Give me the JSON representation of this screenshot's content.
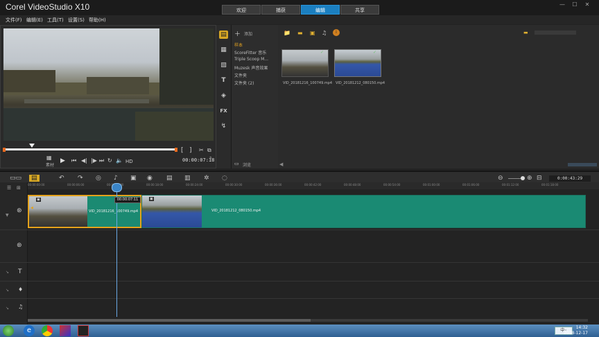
{
  "app": {
    "title": "Corel VideoStudio X10",
    "tabs": [
      {
        "label": "欢迎"
      },
      {
        "label": "捕获"
      },
      {
        "label": "编辑"
      },
      {
        "label": "共享"
      }
    ],
    "active_tab": "编辑",
    "menu": [
      "文件(F)",
      "编辑(E)",
      "工具(T)",
      "设置(S)",
      "帮助(H)"
    ]
  },
  "player": {
    "mode_label": "素材",
    "hd_label": "HD",
    "timecode": "00:00:07:18"
  },
  "library": {
    "add_label": "添加",
    "tree": [
      "样本",
      "ScoreFitter 音乐",
      "Triple Scoop M...",
      "Muzesk 声音效果",
      "文件夹",
      "文件夹 (2)"
    ],
    "browse_label": "浏览",
    "thumbnails": [
      {
        "name": "VID_20181216_100749.mp4"
      },
      {
        "name": "VID_20181212_080150.mp4"
      }
    ]
  },
  "timeline": {
    "duration": "0:00:43:29",
    "ruler_ticks": [
      "00:00:00:00",
      "00:00:06:00",
      "00:00:12:00",
      "00:00:18:00",
      "00:00:24:00",
      "00:00:30:00",
      "00:00:36:00",
      "00:00:42:00",
      "00:00:48:00",
      "00:00:54:00",
      "00:01:00:00",
      "00:01:06:00",
      "00:01:12:00",
      "00:01:18:00"
    ],
    "playhead_time": "00:00:07:11",
    "clips": [
      {
        "name": "VID_20181216_100749.mp4"
      },
      {
        "name": "VID_20181212_080150.mp4"
      }
    ]
  },
  "taskbar": {
    "time": "14:32",
    "date": "2018-12-17"
  },
  "colors": {
    "accent": "#1b7fc0",
    "clip": "#1b8a72",
    "selected_border": "#e5a21b",
    "progress": "#e8691e"
  }
}
